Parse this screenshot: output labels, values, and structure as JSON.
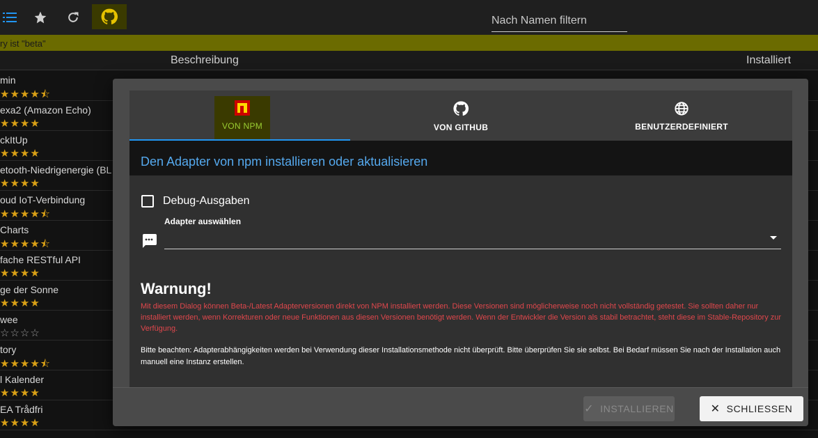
{
  "toolbar": {
    "icons": [
      "list-icon",
      "star-icon",
      "refresh-icon",
      "github-icon"
    ],
    "filter_placeholder": "Nach Namen filtern"
  },
  "beta_banner": "ry ist \"beta\"",
  "columns": {
    "description": "Beschreibung",
    "installed": "Installiert"
  },
  "adapters": [
    {
      "name": "min",
      "stars": "★★★★⯪"
    },
    {
      "name": "exa2 (Amazon Echo)",
      "stars": "★★★★"
    },
    {
      "name": "ckItUp",
      "stars": "★★★★"
    },
    {
      "name": "etooth-Niedrigenergie (BL",
      "stars": "★★★★"
    },
    {
      "name": "oud IoT-Verbindung",
      "stars": "★★★★⯪"
    },
    {
      "name": "Charts",
      "stars": "★★★★⯪"
    },
    {
      "name": "fache RESTful API",
      "stars": "★★★★"
    },
    {
      "name": "ge der Sonne",
      "stars": "★★★★"
    },
    {
      "name": "wee",
      "stars": "☆☆☆☆"
    },
    {
      "name": "tory",
      "stars": "★★★★⯪"
    },
    {
      "name": "l Kalender",
      "stars": "★★★★"
    },
    {
      "name": "EA Trådfri",
      "stars": "★★★★"
    }
  ],
  "dialog": {
    "tabs": [
      {
        "label": "VON NPM",
        "icon": "npm-icon",
        "active": true
      },
      {
        "label": "VON GITHUB",
        "icon": "github-icon",
        "active": false
      },
      {
        "label": "BENUTZERDEFINIERT",
        "icon": "globe-icon",
        "active": false
      }
    ],
    "title": "Den Adapter von npm installieren oder aktualisieren",
    "debug_label": "Debug-Ausgaben",
    "debug_checked": false,
    "select_label": "Adapter auswählen",
    "select_value": "",
    "warning_title": "Warnung!",
    "warning_text": "Mit diesem Dialog können Beta-/Latest Adapterversionen direkt von NPM installiert werden. Diese Versionen sind möglicherweise noch nicht vollständig getestet. Sie sollten daher nur installiert werden, wenn Korrekturen oder neue Funktionen aus diesen Versionen benötigt werden. Wenn der Entwickler die Version als stabil betrachtet, steht diese im Stable-Repository zur Verfügung.",
    "note_text": "Bitte beachten: Adapterabhängigkeiten werden bei Verwendung dieser Installationsmethode nicht überprüft. Bitte überprüfen Sie sie selbst. Bei Bedarf müssen Sie nach der Installation auch manuell eine Instanz erstellen.",
    "install_label": "INSTALLIEREN",
    "close_label": "SCHLIESSEN"
  },
  "colors": {
    "accent": "#2196f3",
    "warning": "#e0474c",
    "star": "#d9a016",
    "beta": "#6b6b00"
  }
}
